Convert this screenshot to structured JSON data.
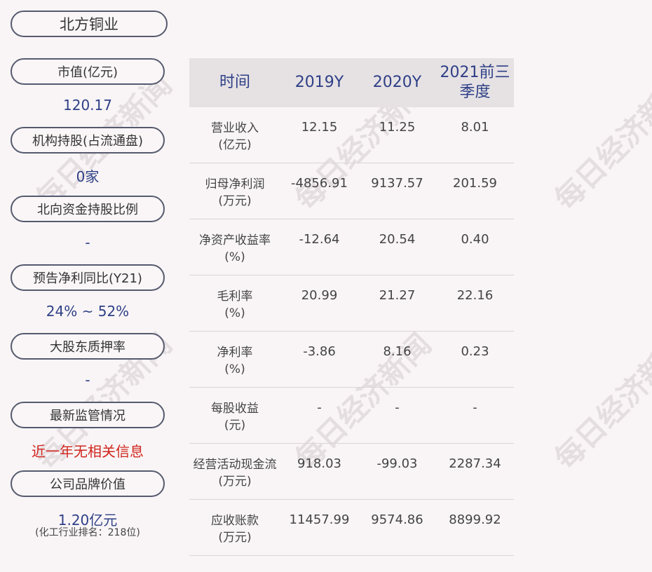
{
  "company": "北方铜业",
  "sidebar": [
    {
      "label": "市值(亿元)",
      "value": "120.17"
    },
    {
      "label": "机构持股(占流通盘)",
      "value": "0家"
    },
    {
      "label": "北向资金持股比例",
      "value": "-"
    },
    {
      "label": "预告净利同比(Y21)",
      "value": "24% ~ 52%"
    },
    {
      "label": "大股东质押率",
      "value": "-"
    },
    {
      "label": "最新监管情况",
      "value": "近一年无相关信息"
    },
    {
      "label": "公司品牌价值",
      "value": "1.20亿元",
      "note": "(化工行业排名：218位)"
    }
  ],
  "table": {
    "headers": [
      "时间",
      "2019Y",
      "2020Y",
      "2021前三季度"
    ],
    "rows": [
      {
        "name": "营业收入",
        "unit": "(亿元)",
        "values": [
          "12.15",
          "11.25",
          "8.01"
        ]
      },
      {
        "name": "归母净利润",
        "unit": "(万元)",
        "values": [
          "-4856.91",
          "9137.57",
          "201.59"
        ]
      },
      {
        "name": "净资产收益率",
        "unit": "(%)",
        "values": [
          "-12.64",
          "20.54",
          "0.40"
        ]
      },
      {
        "name": "毛利率",
        "unit": "(%)",
        "values": [
          "20.99",
          "21.27",
          "22.16"
        ]
      },
      {
        "name": "净利率",
        "unit": "(%)",
        "values": [
          "-3.86",
          "8.16",
          "0.23"
        ]
      },
      {
        "name": "每股收益",
        "unit": "(元)",
        "values": [
          "-",
          "-",
          "-"
        ]
      },
      {
        "name": "经营活动现金流",
        "unit": "(万元)",
        "values": [
          "918.03",
          "-99.03",
          "2287.34"
        ]
      },
      {
        "name": "应收账款",
        "unit": "(万元)",
        "values": [
          "11457.99",
          "9574.86",
          "8899.92"
        ]
      }
    ]
  },
  "watermark": "每日经济新闻",
  "colors": {
    "value_blue": "#2e3f86",
    "alert_red": "#d0261e",
    "header_bg": "#e6e2e4"
  }
}
